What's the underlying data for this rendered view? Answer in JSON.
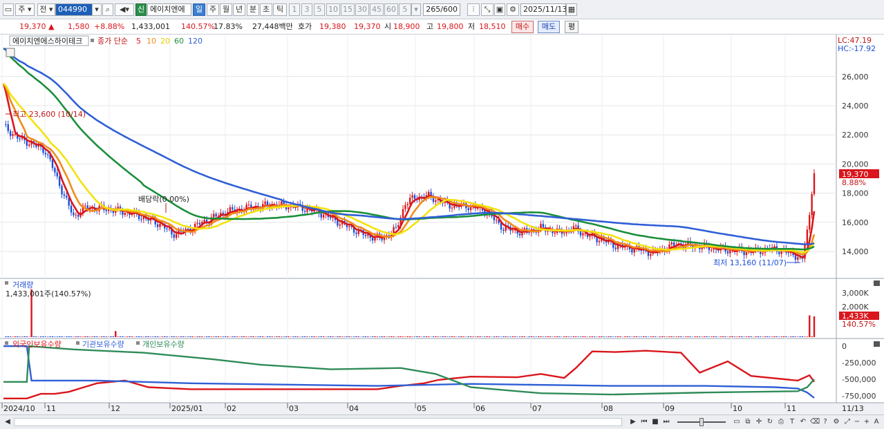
{
  "toolbar": {
    "market": "주",
    "prev": "전",
    "code": "044990",
    "new_badge": "신",
    "stock_name": "에이치엔에",
    "periods": [
      "일",
      "주",
      "월",
      "년",
      "분",
      "초",
      "틱"
    ],
    "active_period": "일",
    "intervals": [
      "1",
      "3",
      "5",
      "10",
      "15",
      "30",
      "45",
      "60"
    ],
    "interval_value": "5",
    "count": "265",
    "count_max": "/600",
    "date": "2025/11/13"
  },
  "quote": {
    "price": "19,370",
    "change": "1,580",
    "change_pct": "+8.88%",
    "volume": "1,433,001",
    "volume_ratio": "140.57%",
    "turnover": "17.83%",
    "amount": "27,448백만",
    "ask_label": "호가",
    "ask1": "19,380",
    "ask2": "19,370",
    "open_label": "시",
    "open": "18,900",
    "high_label": "고",
    "high": "19,800",
    "low_label": "저",
    "low": "18,510",
    "buy_label": "매수",
    "sell_label": "매도",
    "eval_label": "평"
  },
  "price_panel": {
    "stock_label": "에이치엔에스하이테크",
    "ma_label": "종가 단순",
    "ma_periods": [
      "5",
      "10",
      "20",
      "60",
      "120"
    ],
    "ma_colors": [
      "#d9161c",
      "#f08c1a",
      "#f2e30c",
      "#1a8f3a",
      "#2f5fd6"
    ],
    "lc": "LC:47.19",
    "hc": "HC:-17.92",
    "y_ticks": [
      "26,000",
      "24,000",
      "22,000",
      "20,000",
      "18,000",
      "16,000",
      "14,000"
    ],
    "current_price_tag": "19,370",
    "current_pct_tag": "8.88%",
    "high_annotation": "최고 23,600 (10/14)",
    "low_annotation": "최저 13,160 (11/07)",
    "dividend_annotation": "배당락(0.00%)"
  },
  "volume_panel": {
    "title": "거래량",
    "value": "1,433,001주(140.57%)",
    "y_ticks": [
      "3,000K",
      "2,000K"
    ],
    "current_tag": "1,433K",
    "current_pct": "140.57%"
  },
  "holdings_panel": {
    "legend": [
      "외국인보유수량",
      "기관보유수량",
      "개인보유수량"
    ],
    "colors": [
      "#d9161c",
      "#2f5fd6",
      "#2e8b57"
    ],
    "y_ticks": [
      "0",
      "-250,000",
      "-500,000",
      "-750,000"
    ]
  },
  "x_axis": [
    "2024/10",
    "11",
    "12",
    "2025/01",
    "02",
    "03",
    "04",
    "05",
    "06",
    "07",
    "08",
    "09",
    "10",
    "11",
    "11/13"
  ]
}
